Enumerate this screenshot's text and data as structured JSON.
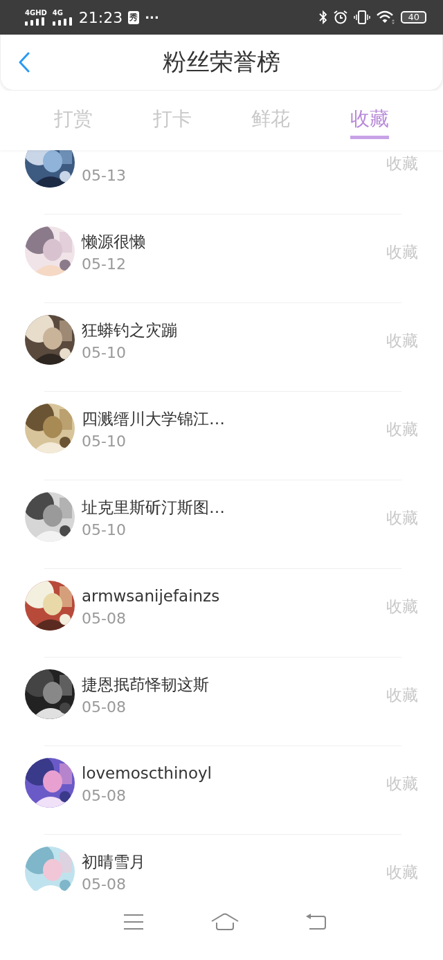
{
  "status_bar": {
    "network_1": "4GHD",
    "network_2": "4G",
    "time": "21:23",
    "app_badge": "秀",
    "more": "···",
    "battery": "40"
  },
  "header": {
    "title": "粉丝荣誉榜"
  },
  "tabs": [
    {
      "label": "打赏",
      "selected": false
    },
    {
      "label": "打卡",
      "selected": false
    },
    {
      "label": "鲜花",
      "selected": false
    },
    {
      "label": "收藏",
      "selected": true
    }
  ],
  "rows": [
    {
      "date": "05-13",
      "action": "收藏"
    },
    {
      "name": "懒源很懒",
      "date": "05-12",
      "action": "收藏"
    },
    {
      "name": "狂蟒钓之灾蹦",
      "date": "05-10",
      "action": "收藏"
    },
    {
      "name": "四溅缙川大学锦江…",
      "date": "05-10",
      "action": "收藏"
    },
    {
      "name": "址克里斯斫汀斯图…",
      "date": "05-10",
      "action": "收藏"
    },
    {
      "name": "armwsanijefainzs",
      "date": "05-08",
      "action": "收藏"
    },
    {
      "name": "捷恩抿茚怿韧这斯",
      "date": "05-08",
      "action": "收藏"
    },
    {
      "name": "lovemoscthinoyl",
      "date": "05-08",
      "action": "收藏"
    },
    {
      "name": "初晴雪月",
      "date": "05-08",
      "action": "收藏"
    }
  ]
}
